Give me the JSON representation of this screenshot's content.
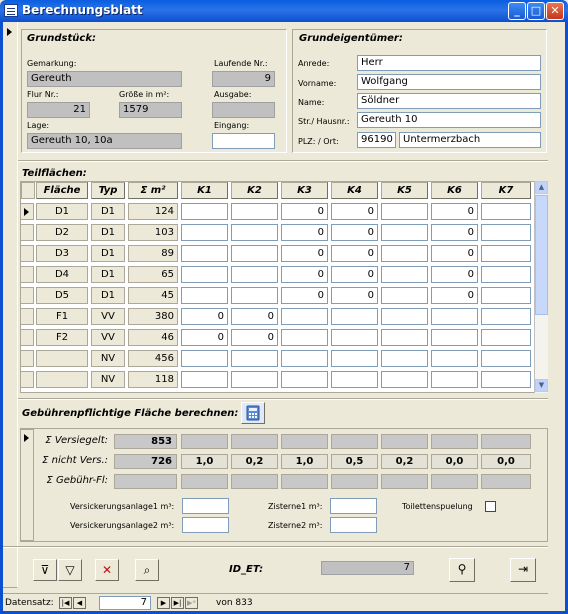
{
  "window": {
    "title": "Berechnungsblatt"
  },
  "grundstueck": {
    "header": "Grundstück:",
    "gemarkung_label": "Gemarkung:",
    "gemarkung": "Gereuth",
    "laufende_label": "Laufende Nr.:",
    "laufende": "9",
    "flur_label": "Flur Nr.:",
    "flur": "21",
    "groesse_label": "Größe in m²:",
    "groesse": "1579",
    "ausgabe_label": "Ausgabe:",
    "lage_label": "Lage:",
    "lage": "Gereuth 10, 10a",
    "eingang_label": "Eingang:"
  },
  "eigentuemer": {
    "header": "Grundeigentümer:",
    "anrede_label": "Anrede:",
    "anrede": "Herr",
    "vorname_label": "Vorname:",
    "vorname": "Wolfgang",
    "name_label": "Name:",
    "name": "Söldner",
    "strasse_label": "Str./ Hausnr.:",
    "strasse": "Gereuth 10",
    "plz_label": "PLZ: / Ort:",
    "plz": "96190",
    "ort": "Untermerzbach"
  },
  "teilflaechen": {
    "header": "Teilflächen:",
    "columns": [
      "Fläche",
      "Typ",
      "Σ m²",
      "K1",
      "K2",
      "K3",
      "K4",
      "K5",
      "K6",
      "K7"
    ],
    "rows": [
      [
        "D1",
        "D1",
        "124",
        "",
        "",
        "0",
        "0",
        "",
        "0",
        ""
      ],
      [
        "D2",
        "D1",
        "103",
        "",
        "",
        "0",
        "0",
        "",
        "0",
        ""
      ],
      [
        "D3",
        "D1",
        "89",
        "",
        "",
        "0",
        "0",
        "",
        "0",
        ""
      ],
      [
        "D4",
        "D1",
        "65",
        "",
        "",
        "0",
        "0",
        "",
        "0",
        ""
      ],
      [
        "D5",
        "D1",
        "45",
        "",
        "",
        "0",
        "0",
        "",
        "0",
        ""
      ],
      [
        "F1",
        "VV",
        "380",
        "0",
        "0",
        "",
        "",
        "",
        "",
        ""
      ],
      [
        "F2",
        "VV",
        "46",
        "0",
        "0",
        "",
        "",
        "",
        "",
        ""
      ],
      [
        "",
        "NV",
        "456",
        "",
        "",
        "",
        "",
        "",
        "",
        ""
      ],
      [
        "",
        "NV",
        "118",
        "",
        "",
        "",
        "",
        "",
        "",
        ""
      ]
    ]
  },
  "gebuehren": {
    "header": "Gebührenpflichtige Fläche berechnen:",
    "versiegelt_label": "Σ Versiegelt:",
    "versiegelt": "853",
    "nichtvers_label": "Σ nicht Vers.:",
    "nichtvers": "726",
    "factors": [
      "1,0",
      "0,2",
      "1,0",
      "0,5",
      "0,2",
      "0,0",
      "0,0"
    ],
    "gebuehr_label": "Σ Gebühr-Fl:",
    "vers1_label": "Versickerungsanlage1 m³:",
    "vers2_label": "Versickerungsanlage2 m³:",
    "zist1_label": "Zisterne1 m³:",
    "zist2_label": "Zisterne2 m³:",
    "toilette_label": "Toilettenspuelung"
  },
  "footer": {
    "id_label": "ID_ET:",
    "id_value": "7"
  },
  "nav": {
    "label": "Datensatz:",
    "current": "7",
    "of_label": "von 833"
  }
}
